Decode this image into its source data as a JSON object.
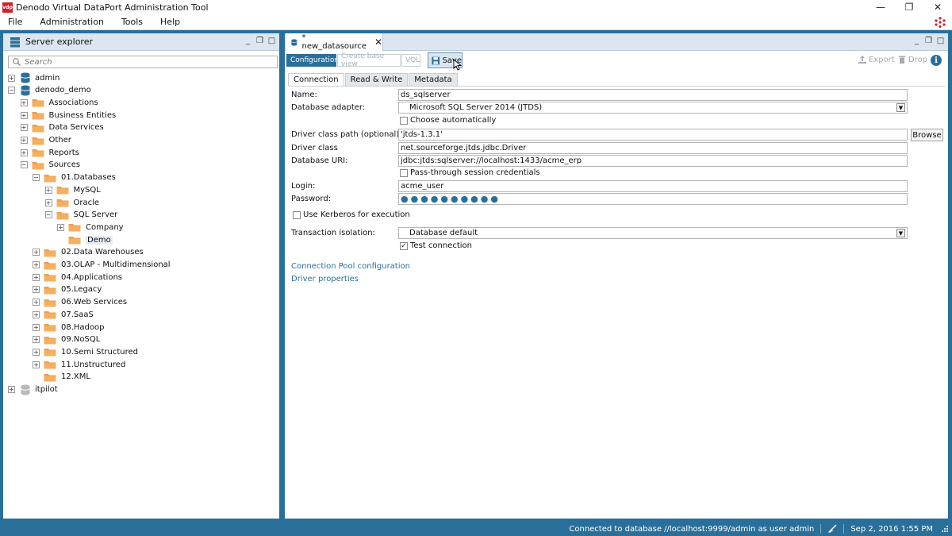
{
  "window": {
    "logo_text": "vdp",
    "title": "Denodo Virtual DataPort Administration Tool",
    "minimize": "—",
    "restore": "❐",
    "close": "✕"
  },
  "menu": [
    "File",
    "Administration",
    "Tools",
    "Help"
  ],
  "explorer": {
    "title": "Server explorer",
    "search_placeholder": "Search",
    "tree": [
      {
        "label": "admin",
        "type": "database",
        "toggle": "+",
        "level": 0
      },
      {
        "label": "denodo_demo",
        "type": "database",
        "toggle": "−",
        "level": 0
      },
      {
        "label": "Associations",
        "type": "folder",
        "toggle": "+",
        "level": 1
      },
      {
        "label": "Business Entities",
        "type": "folder",
        "toggle": "+",
        "level": 1
      },
      {
        "label": "Data Services",
        "type": "folder",
        "toggle": "+",
        "level": 1
      },
      {
        "label": "Other",
        "type": "folder",
        "toggle": "+",
        "level": 1
      },
      {
        "label": "Reports",
        "type": "folder",
        "toggle": "+",
        "level": 1
      },
      {
        "label": "Sources",
        "type": "folder",
        "toggle": "−",
        "level": 1
      },
      {
        "label": "01.Databases",
        "type": "folder",
        "toggle": "−",
        "level": 2
      },
      {
        "label": "MySQL",
        "type": "folder",
        "toggle": "+",
        "level": 3
      },
      {
        "label": "Oracle",
        "type": "folder",
        "toggle": "+",
        "level": 3
      },
      {
        "label": "SQL Server",
        "type": "folder",
        "toggle": "−",
        "level": 3
      },
      {
        "label": "Company",
        "type": "folder",
        "toggle": "+",
        "level": 4
      },
      {
        "label": "Demo",
        "type": "folder",
        "toggle": "",
        "level": 4,
        "selected": true
      },
      {
        "label": "02.Data Warehouses",
        "type": "folder",
        "toggle": "+",
        "level": 2
      },
      {
        "label": "03.OLAP - Multidimensional",
        "type": "folder",
        "toggle": "+",
        "level": 2
      },
      {
        "label": "04.Applications",
        "type": "folder",
        "toggle": "+",
        "level": 2
      },
      {
        "label": "05.Legacy",
        "type": "folder",
        "toggle": "+",
        "level": 2
      },
      {
        "label": "06.Web Services",
        "type": "folder",
        "toggle": "+",
        "level": 2
      },
      {
        "label": "07.SaaS",
        "type": "folder",
        "toggle": "+",
        "level": 2
      },
      {
        "label": "08.Hadoop",
        "type": "folder",
        "toggle": "+",
        "level": 2
      },
      {
        "label": "09.NoSQL",
        "type": "folder",
        "toggle": "+",
        "level": 2
      },
      {
        "label": "10.Semi Structured",
        "type": "folder",
        "toggle": "+",
        "level": 2
      },
      {
        "label": "11.Unstructured",
        "type": "folder",
        "toggle": "+",
        "level": 2
      },
      {
        "label": "12.XML",
        "type": "folder",
        "toggle": "",
        "level": 2
      },
      {
        "label": "itpilot",
        "type": "database-grey",
        "toggle": "+",
        "level": 0
      }
    ]
  },
  "editor": {
    "tab_label": "* new_datasource",
    "tab_close": "✕",
    "toolbar": {
      "configuration": "Configuration",
      "create_base_view": "Create base view",
      "vql": "VQL",
      "save": "Save",
      "export": "Export",
      "drop": "Drop",
      "info": "i"
    },
    "subtabs": [
      "Connection",
      "Read & Write",
      "Metadata"
    ],
    "form": {
      "name_label": "Name:",
      "name_value": "ds_sqlserver",
      "adapter_label": "Database adapter:",
      "adapter_value": "Microsoft SQL Server 2014 (JTDS)",
      "choose_auto_label": "Choose automatically",
      "driver_path_label": "Driver class path (optional):",
      "driver_path_value": "'jtds-1.3.1'",
      "browse": "Browse",
      "driver_class_label": "Driver class",
      "driver_class_value": "net.sourceforge.jtds.jdbc.Driver",
      "uri_label": "Database URI:",
      "uri_value": "jdbc:jtds:sqlserver://localhost:1433/acme_erp",
      "passthrough_label": "Pass-through session credentials",
      "login_label": "Login:",
      "login_value": "acme_user",
      "password_label": "Password:",
      "password_value": "●●●●●●●●●●",
      "kerberos_label": "Use Kerberos for execution",
      "isolation_label": "Transaction isolation:",
      "isolation_value": "Database default",
      "test_connection_label": "Test connection",
      "test_connection_checked": "✓",
      "pool_link": "Connection Pool configuration",
      "driver_props_link": "Driver properties"
    }
  },
  "status": {
    "connection": "Connected to database //localhost:9999/admin as user admin",
    "datetime": "Sep 2, 2016 1:55 PM"
  },
  "colors": {
    "accent": "#2a6f9a",
    "folder": "#f0a04b",
    "database": "#2a6f9a"
  }
}
